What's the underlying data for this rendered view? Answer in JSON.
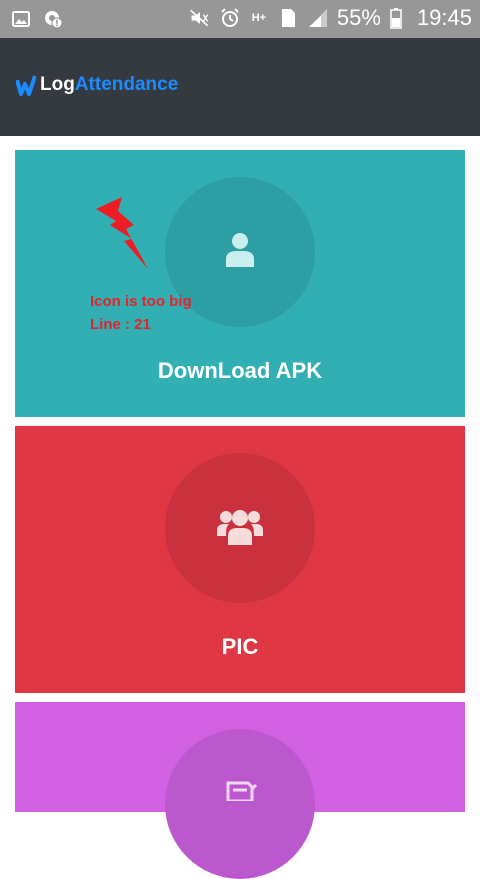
{
  "status_bar": {
    "battery": "55%",
    "time": "19:45",
    "icons": [
      "image-icon",
      "settings-alert-icon",
      "mute-icon",
      "alarm-icon",
      "hplus-network-icon",
      "sim1-icon",
      "signal-icon",
      "battery-icon"
    ],
    "network_label": "H+",
    "sim_label": "1"
  },
  "header": {
    "brand_part1": "Log",
    "brand_part2": "Attendance",
    "colors": {
      "background": "#343a40",
      "accent": "#1a8cff"
    }
  },
  "cards": [
    {
      "label": "DownLoad APK",
      "icon": "user-icon",
      "color": "#31afb3"
    },
    {
      "label": "PIC",
      "icon": "users-icon",
      "color": "#df3744"
    },
    {
      "label": "",
      "icon": "document-icon",
      "color": "#d062e2"
    }
  ],
  "annotation": {
    "line1": "Icon is too big",
    "line2": "Line : 21",
    "color": "#e8202a"
  }
}
